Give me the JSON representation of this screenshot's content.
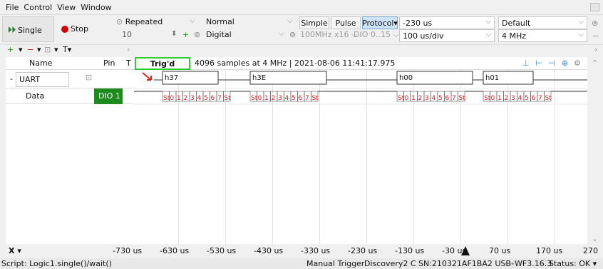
{
  "menu": [
    "File",
    "Control",
    "View",
    "Window"
  ],
  "toolbar": {
    "single_label": "Single",
    "stop_label": "Stop",
    "mode": "Repeated",
    "samples": "10",
    "trigger_mode": "Normal",
    "trigger_source": "Digital",
    "simple_label": "Simple",
    "pulse_label": "Pulse",
    "protocol_label": "Protocol",
    "rate": "100MHz x16",
    "dio_range": "DIO 0..15",
    "position": "-230 us",
    "base": "100 us/div",
    "config": "Default",
    "freq": "4 MHz"
  },
  "channel_header": {
    "name": "Name",
    "pin": "Pin",
    "t": "T",
    "trigd": "Trig'd"
  },
  "info_text": "4096 samples at 4 MHz | 2021-08-06 11:41:17.975",
  "channels": [
    {
      "name": "UART",
      "pin": "",
      "minus": "-"
    },
    {
      "name": "Data",
      "pin": "DIO 1"
    }
  ],
  "uart_values": [
    "h37",
    "h3E",
    "h00",
    "h01"
  ],
  "bit_labels": [
    "St",
    "0",
    "1",
    "2",
    "3",
    "4",
    "5",
    "6",
    "7",
    "St"
  ],
  "time_axis": [
    "-730 us",
    "-630 us",
    "-530 us",
    "-430 us",
    "-330 us",
    "-230 us",
    "-130 us",
    "-30 us",
    "70 us",
    "170 us",
    "270 us"
  ],
  "x_label": "X",
  "status": {
    "script": "Script: Logic1.single()/wait()",
    "trigger": "Manual Trigger",
    "device": "Discovery2 C SN:210321AF1BA2 USB",
    "firmware": "WF3.16.3",
    "state": "Status: OK"
  },
  "colors": {
    "accent_green": "#1e8a1e",
    "red": "#e02020",
    "trig_border": "#2ecc2e"
  }
}
